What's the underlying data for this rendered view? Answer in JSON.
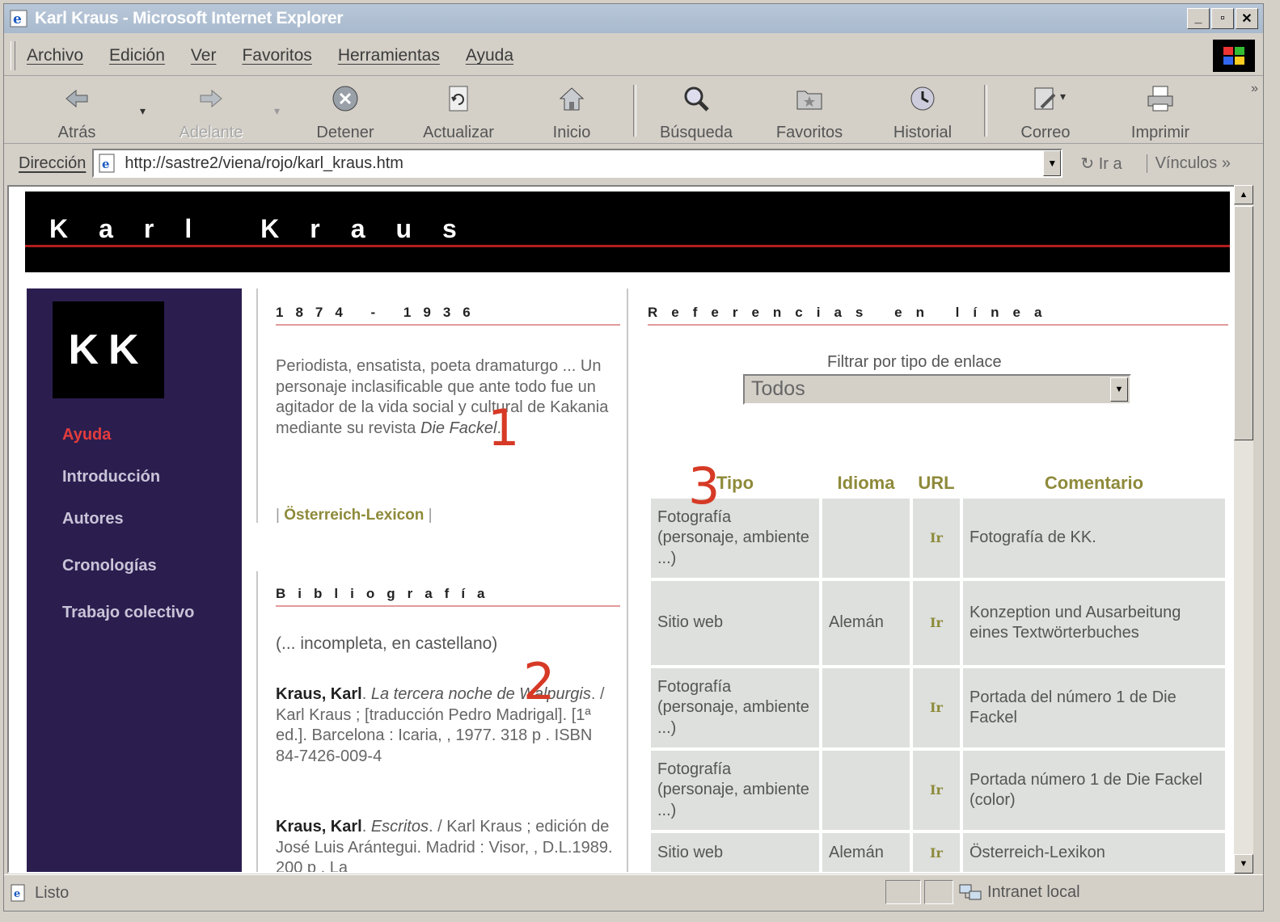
{
  "window": {
    "title": "Karl Kraus - Microsoft Internet Explorer"
  },
  "menu": [
    "Archivo",
    "Edición",
    "Ver",
    "Favoritos",
    "Herramientas",
    "Ayuda"
  ],
  "toolbar": {
    "back": "Atrás",
    "forward": "Adelante",
    "stop": "Detener",
    "refresh": "Actualizar",
    "home": "Inicio",
    "search": "Búsqueda",
    "favorites": "Favoritos",
    "history": "Historial",
    "mail": "Correo",
    "print": "Imprimir"
  },
  "address": {
    "label": "Dirección",
    "url": "http://sastre2/viena/rojo/karl_kraus.htm",
    "go": "Ir a",
    "links": "Vínculos"
  },
  "page": {
    "banner_title": "Karl  Kraus",
    "logo": "KK",
    "nav": [
      "Ayuda",
      "Introducción",
      "Autores",
      "Cronologías",
      "Trabajo colectivo"
    ],
    "dates_heading": "1874 - 1936",
    "bio_text": "Periodista, ensatista, poeta dramaturgo ... Un personaje inclasificable que ante todo fue un agitador de la vida social y cultural de Kakania mediante su revista ",
    "bio_journal": "Die Fackel",
    "lexicon_link": "Österreich-Lexicon",
    "biblio_heading": "Bibliografía",
    "biblio_note": "(... incompleta, en castellano)",
    "biblio": [
      {
        "author": "Kraus, Karl",
        "title": "La tercera noche de Walpurgis",
        "rest": " / Karl Kraus ; [traducción Pedro Madrigal]. [1ª ed.]. Barcelona : Icaria, , 1977. 318 p . ISBN 84-7426-009-4"
      },
      {
        "author": "Kraus, Karl",
        "title": "Escritos",
        "rest": " / Karl Kraus ; edición de José Luis Arántegui. Madrid : Visor, , D.L.1989. 200 p . La"
      }
    ],
    "refs_heading": "Referencias en línea",
    "filter_label": "Filtrar por tipo de enlace",
    "filter_value": "Todos",
    "table_headers": [
      "Tipo",
      "Idioma",
      "URL",
      "Comentario"
    ],
    "rows": [
      {
        "tipo": "Fotografía (personaje, ambiente ...)",
        "idioma": "",
        "url": "Ir",
        "comentario": "Fotografía de KK."
      },
      {
        "tipo": "Sitio web",
        "idioma": "Alemán",
        "url": "Ir",
        "comentario": "Konzeption und Ausarbeitung eines Textwörterbuches"
      },
      {
        "tipo": "Fotografía (personaje, ambiente ...)",
        "idioma": "",
        "url": "Ir",
        "comentario": "Portada del número 1 de Die Fackel"
      },
      {
        "tipo": "Fotografía (personaje, ambiente ...)",
        "idioma": "",
        "url": "Ir",
        "comentario": "Portada número 1 de Die Fackel (color)"
      },
      {
        "tipo": "Sitio web",
        "idioma": "Alemán",
        "url": "Ir",
        "comentario": "Österreich-Lexikon"
      }
    ],
    "annotations": [
      "1",
      "2",
      "3"
    ]
  },
  "status": {
    "text": "Listo",
    "zone": "Intranet local"
  }
}
